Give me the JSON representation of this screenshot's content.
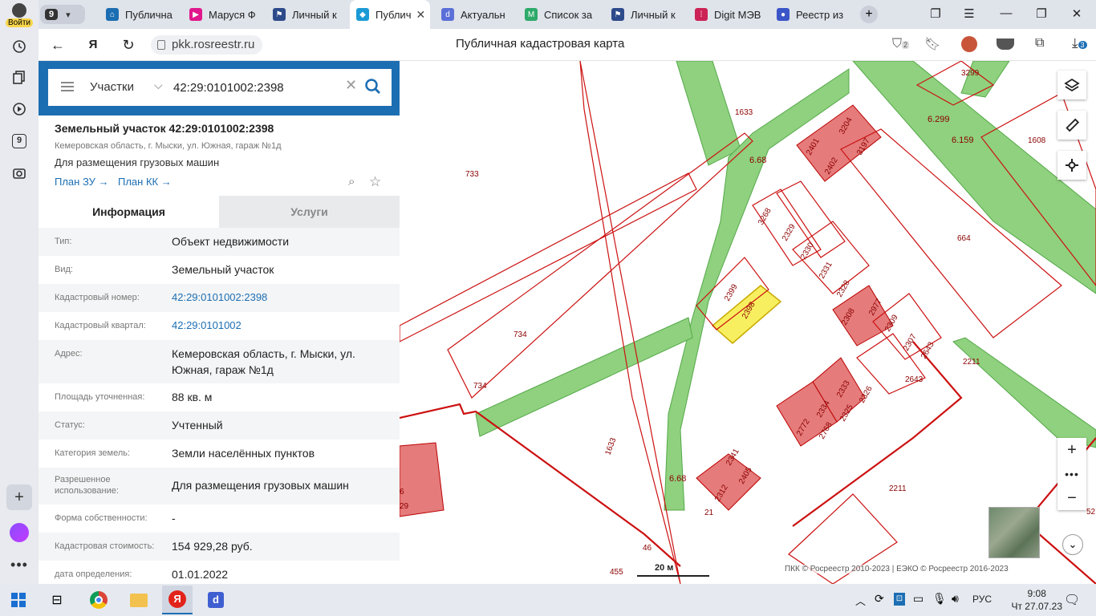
{
  "browser": {
    "login_label": "Войти",
    "counter_badge": "9",
    "sidebar_badge": "9",
    "tabs": [
      {
        "label": "Публична",
        "icon": "house-icon",
        "color": "#1c6eb3"
      },
      {
        "label": "Маруся Ф",
        "icon": "play-icon",
        "color": "#e0188c"
      },
      {
        "label": "Личный к",
        "icon": "flag-icon",
        "color": "#2d4a8a"
      },
      {
        "label": "Публич",
        "icon": "pkk-icon",
        "color": "#1c9ad6"
      },
      {
        "label": "Актуальн",
        "icon": "d-icon",
        "color": "#5b6fd8"
      },
      {
        "label": "Список за",
        "icon": "m-icon",
        "color": "#2eaa6a"
      },
      {
        "label": "Личный к",
        "icon": "flag-icon",
        "color": "#2d4a8a"
      },
      {
        "label": "Digit МЭВ",
        "icon": "dots-icon",
        "color": "#cc2255"
      },
      {
        "label": "Реестр из",
        "icon": "globe-icon",
        "color": "#3a55c8"
      }
    ],
    "url": "pkk.rosreestr.ru",
    "page_title": "Публичная кадастровая карта",
    "badge_left": "2",
    "badge_download": "3"
  },
  "search": {
    "type_label": "Участки",
    "query": "42:29:0101002:2398"
  },
  "feature": {
    "title": "Земельный участок 42:29:0101002:2398",
    "address": "Кемеровская область, г. Мыски, ул. Южная, гараж №1д",
    "use": "Для размещения грузовых машин",
    "plan_zu": "План ЗУ →",
    "plan_kk": "План КК →"
  },
  "panel_tabs": {
    "info": "Информация",
    "services": "Услуги"
  },
  "attributes": [
    {
      "key": "Тип:",
      "value": "Объект недвижимости",
      "link": false
    },
    {
      "key": "Вид:",
      "value": "Земельный участок",
      "link": false
    },
    {
      "key": "Кадастровый номер:",
      "value": "42:29:0101002:2398",
      "link": true
    },
    {
      "key": "Кадастровый квартал:",
      "value": "42:29:0101002",
      "link": true
    },
    {
      "key": "Адрес:",
      "value": "Кемеровская область, г. Мыски, ул. Южная, гараж №1д",
      "link": false
    },
    {
      "key": "Площадь уточненная:",
      "value": "88 кв. м",
      "link": false
    },
    {
      "key": "Статус:",
      "value": "Учтенный",
      "link": false
    },
    {
      "key": "Категория земель:",
      "value": "Земли населённых пунктов",
      "link": false
    },
    {
      "key": "Разрешенное использование:",
      "value": "Для размещения грузовых машин",
      "link": false
    },
    {
      "key": "Форма собственности:",
      "value": "-",
      "link": false
    },
    {
      "key": "Кадастровая стоимость:",
      "value": "154 929,28 руб.",
      "link": false
    },
    {
      "key": "дата определения:",
      "value": "01.01.2022",
      "link": false
    }
  ],
  "map": {
    "scale": "20 м",
    "copyright": "ПКК © Росреестр 2010-2023 | ЕЭКО © Росреестр 2016-2023",
    "labels": [
      "3299",
      "1633",
      "3204",
      "2401",
      "3197",
      "2402",
      "6.299",
      "6.159",
      "1608",
      "6.68",
      "733",
      "3268",
      "2329",
      "2330",
      "664",
      "2331",
      "2399",
      "2398",
      "2328",
      "2977",
      "2308",
      "2309",
      "734",
      "2307",
      "2643",
      "2211",
      "2643",
      "734",
      "2333",
      "2326",
      "2334",
      "2325",
      "2772",
      "2768",
      "1633",
      "2341",
      "2405",
      "2312",
      "6.68",
      "2211",
      "6",
      "29",
      "21",
      "46",
      "455",
      "52"
    ]
  },
  "taskbar": {
    "lang": "РУС",
    "time": "9:08",
    "date": "Чт 27.07.23"
  }
}
